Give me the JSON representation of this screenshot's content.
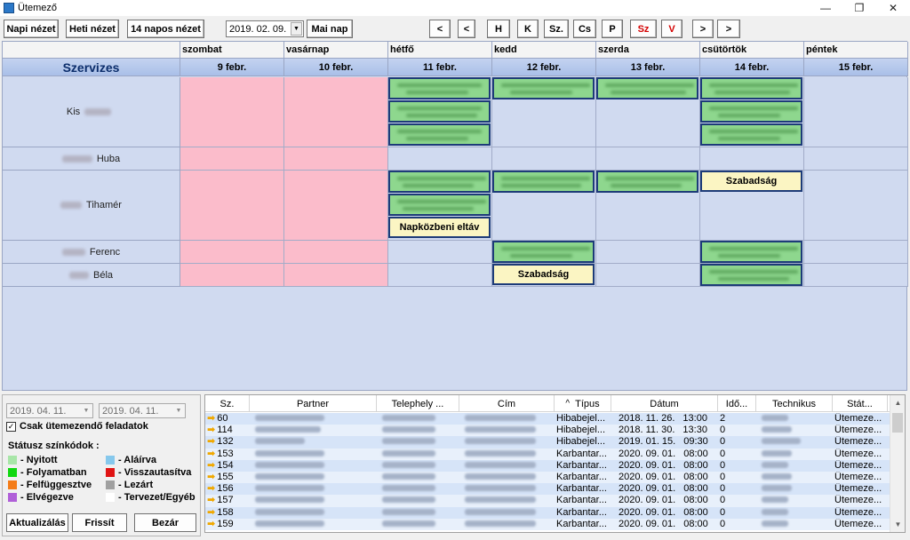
{
  "window": {
    "title": "Ütemező",
    "minimize": "—",
    "restore": "❐",
    "close": "✕"
  },
  "toolbar": {
    "day_view": "Napi nézet",
    "week_view": "Heti nézet",
    "fourteen_day_view": "14 napos nézet",
    "date_value": "2019. 02. 09.",
    "today": "Mai nap",
    "nav": [
      "<",
      "<",
      "H",
      "K",
      "Sz.",
      "Cs",
      "P",
      "Sz",
      "V",
      ">",
      ">"
    ]
  },
  "calendar": {
    "service_header": "Szervizes",
    "days": [
      {
        "name": "szombat",
        "date": "9 febr.",
        "weekend": true
      },
      {
        "name": "vasárnap",
        "date": "10 febr.",
        "weekend": true
      },
      {
        "name": "hétfő",
        "date": "11 febr.",
        "weekend": false
      },
      {
        "name": "kedd",
        "date": "12 febr.",
        "weekend": false
      },
      {
        "name": "szerda",
        "date": "13 febr.",
        "weekend": false
      },
      {
        "name": "csütörtök",
        "date": "14 febr.",
        "weekend": false
      },
      {
        "name": "péntek",
        "date": "15 febr.",
        "weekend": false
      }
    ],
    "technicians": [
      {
        "visible": "Kis"
      },
      {
        "visible": "Huba"
      },
      {
        "visible": "Tihamér"
      },
      {
        "visible": "Ferenc"
      },
      {
        "visible": "Béla"
      }
    ],
    "events": {
      "lunch": "Napközbeni eltáv",
      "vacation1": "Szabadság",
      "vacation2": "Szabadság"
    }
  },
  "filters": {
    "date_from": "2019. 04. 11.",
    "date_to": "2019. 04. 11.",
    "only_scheduled": "Csak ütemezendő feladatok",
    "only_scheduled_checked": true,
    "check_mark": "✓",
    "legend_title": "Státusz színkódok :",
    "legend": [
      {
        "label": "- Nyitott",
        "color": "#a8e6a8"
      },
      {
        "label": "- Folyamatban",
        "color": "#11d811"
      },
      {
        "label": "- Felfüggesztve",
        "color": "#f47c18"
      },
      {
        "label": "- Elvégezve",
        "color": "#b05fd8"
      },
      {
        "label": "- Aláírva",
        "color": "#86c8ec"
      },
      {
        "label": "- Visszautasítva",
        "color": "#e01414"
      },
      {
        "label": "- Lezárt",
        "color": "#a0a0a0"
      },
      {
        "label": "- Tervezet/Egyéb",
        "color": "#ffffff"
      }
    ],
    "refresh_all": "Aktualizálás",
    "refresh": "Frissít",
    "close": "Bezár"
  },
  "table": {
    "columns": [
      "Sz.",
      "Partner",
      "Telephely ...",
      "Cím",
      "Típus",
      "Dátum",
      "Idő...",
      "Technikus",
      "Stát..."
    ],
    "sort_indicator": "^",
    "rows": [
      {
        "id": "60",
        "type": "Hibabejel...",
        "date": "2018. 11. 26.",
        "time": "13:00",
        "ido": "2",
        "status": "Ütemeze..."
      },
      {
        "id": "114",
        "type": "Hibabejel...",
        "date": "2018. 11. 30.",
        "time": "13:30",
        "ido": "0",
        "status": "Ütemeze..."
      },
      {
        "id": "132",
        "type": "Hibabejel...",
        "date": "2019. 01. 15.",
        "time": "09:30",
        "ido": "0",
        "status": "Ütemeze..."
      },
      {
        "id": "153",
        "type": "Karbantar...",
        "date": "2020. 09. 01.",
        "time": "08:00",
        "ido": "0",
        "status": "Ütemeze..."
      },
      {
        "id": "154",
        "type": "Karbantar...",
        "date": "2020. 09. 01.",
        "time": "08:00",
        "ido": "0",
        "status": "Ütemeze..."
      },
      {
        "id": "155",
        "type": "Karbantar...",
        "date": "2020. 09. 01.",
        "time": "08:00",
        "ido": "0",
        "status": "Ütemeze..."
      },
      {
        "id": "156",
        "type": "Karbantar...",
        "date": "2020. 09. 01.",
        "time": "08:00",
        "ido": "0",
        "status": "Ütemeze..."
      },
      {
        "id": "157",
        "type": "Karbantar...",
        "date": "2020. 09. 01.",
        "time": "08:00",
        "ido": "0",
        "status": "Ütemeze..."
      },
      {
        "id": "158",
        "type": "Karbantar...",
        "date": "2020. 09. 01.",
        "time": "08:00",
        "ido": "0",
        "status": "Ütemeze..."
      },
      {
        "id": "159",
        "type": "Karbantar...",
        "date": "2020. 09. 01.",
        "time": "08:00",
        "ido": "0",
        "status": "Ütemeze..."
      }
    ]
  }
}
